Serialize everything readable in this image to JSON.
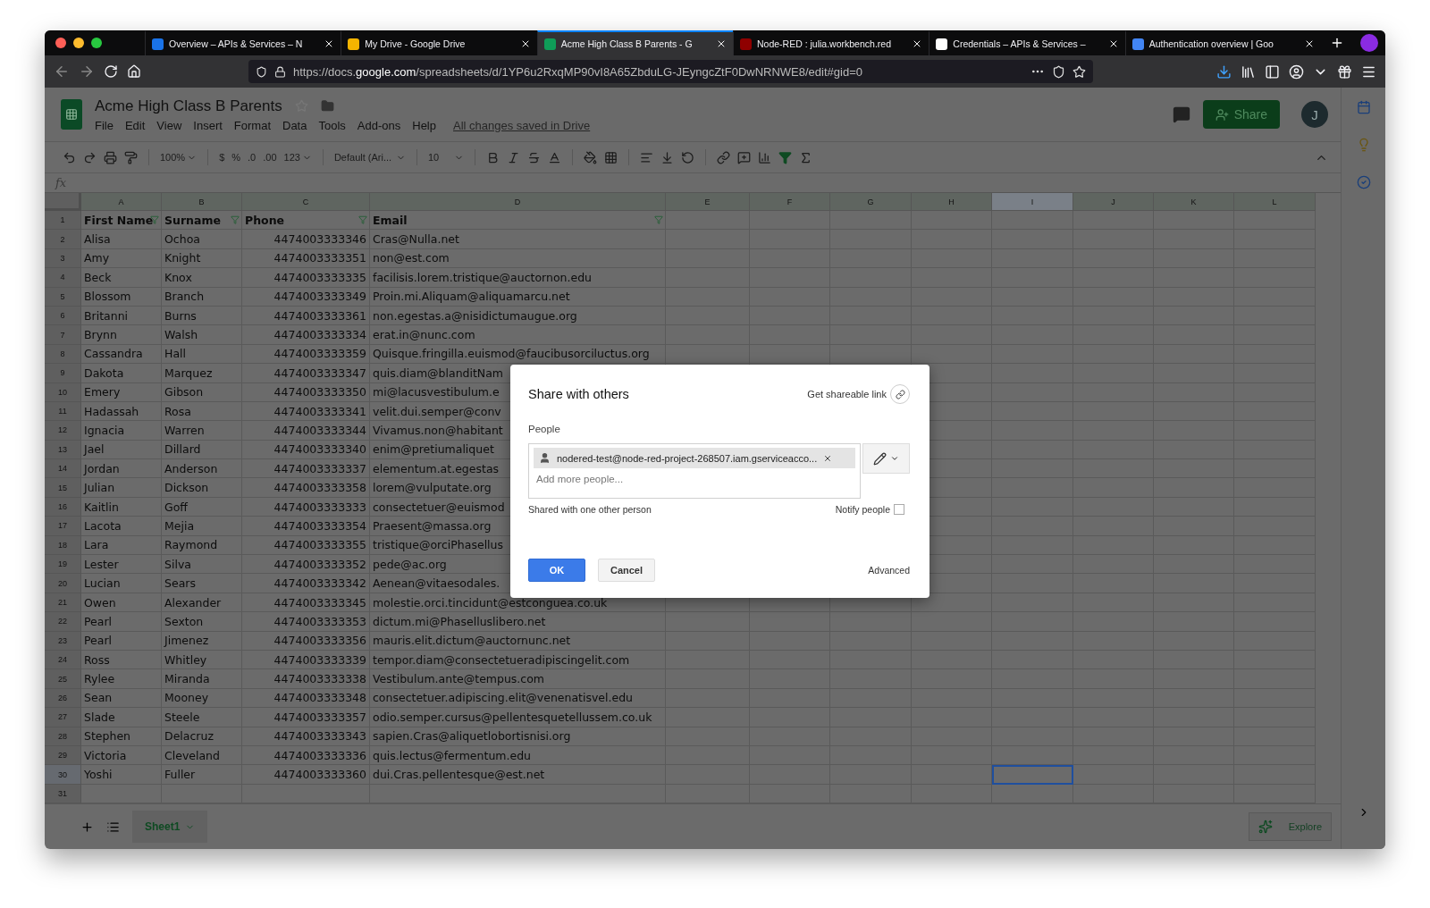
{
  "browser": {
    "tabs": [
      {
        "title": "Overview – APIs & Services – N",
        "selected": false
      },
      {
        "title": "My Drive - Google Drive",
        "selected": false
      },
      {
        "title": "Acme High Class B Parents - G",
        "selected": true
      },
      {
        "title": "Node-RED : julia.workbench.red",
        "selected": false
      },
      {
        "title": "Credentials – APIs & Services –",
        "selected": false
      },
      {
        "title": "Authentication overview  |  Goo",
        "selected": false
      }
    ],
    "url": {
      "prefix": "https://docs.",
      "host": "google.com",
      "path": "/spreadsheets/d/1YP6u2RxqMP90vI8A65ZbduLG-JEyngcZtF0DwNRNWE8/edit#gid=0"
    }
  },
  "doc": {
    "title": "Acme High Class B Parents",
    "menu": [
      "File",
      "Edit",
      "View",
      "Insert",
      "Format",
      "Data",
      "Tools",
      "Add-ons",
      "Help"
    ],
    "save_status": "All changes saved in Drive",
    "share_button": "Share",
    "avatar": "J"
  },
  "toolbar": {
    "zoom": "100%",
    "currency": "$",
    "percent": "%",
    "decrease_decimals": ".0",
    "increase_decimals": ".00",
    "more_formats": "123",
    "font": "Default (Ari...",
    "font_size": "10"
  },
  "formula_bar": {
    "label": "fx"
  },
  "sheet": {
    "columns": [
      {
        "label": "A",
        "selected": false
      },
      {
        "label": "B",
        "selected": false
      },
      {
        "label": "C",
        "selected": false
      },
      {
        "label": "D",
        "selected": false
      },
      {
        "label": "E",
        "selected": false
      },
      {
        "label": "F",
        "selected": false
      },
      {
        "label": "G",
        "selected": false
      },
      {
        "label": "H",
        "selected": false
      },
      {
        "label": "I",
        "selected": true
      },
      {
        "label": "J",
        "selected": false
      },
      {
        "label": "K",
        "selected": false
      },
      {
        "label": "L",
        "selected": false
      }
    ],
    "rows": [
      {
        "number": "1",
        "kind": "header",
        "selected": false,
        "cells": [
          "First Name",
          "Surname",
          "Phone",
          "Email"
        ]
      },
      {
        "number": "2",
        "kind": "data",
        "selected": false,
        "cells": [
          "Alisa",
          "Ochoa",
          "4474003333346",
          "Cras@Nulla.net"
        ]
      },
      {
        "number": "3",
        "kind": "data",
        "selected": false,
        "cells": [
          "Amy",
          "Knight",
          "4474003333351",
          "non@est.com"
        ]
      },
      {
        "number": "4",
        "kind": "data",
        "selected": false,
        "cells": [
          "Beck",
          "Knox",
          "4474003333335",
          "facilisis.lorem.tristique@auctornon.edu"
        ]
      },
      {
        "number": "5",
        "kind": "data",
        "selected": false,
        "cells": [
          "Blossom",
          "Branch",
          "4474003333349",
          "Proin.mi.Aliquam@aliquamarcu.net"
        ]
      },
      {
        "number": "6",
        "kind": "data",
        "selected": false,
        "cells": [
          "Britanni",
          "Burns",
          "4474003333361",
          "non.egestas.a@nisidictumaugue.org"
        ]
      },
      {
        "number": "7",
        "kind": "data",
        "selected": false,
        "cells": [
          "Brynn",
          "Walsh",
          "4474003333334",
          "erat.in@nunc.com"
        ]
      },
      {
        "number": "8",
        "kind": "data",
        "selected": false,
        "cells": [
          "Cassandra",
          "Hall",
          "4474003333359",
          "Quisque.fringilla.euismod@faucibusorciluctus.org"
        ]
      },
      {
        "number": "9",
        "kind": "data",
        "selected": false,
        "cells": [
          "Dakota",
          "Marquez",
          "4474003333347",
          "quis.diam@blanditNam"
        ]
      },
      {
        "number": "10",
        "kind": "data",
        "selected": false,
        "cells": [
          "Emery",
          "Gibson",
          "4474003333350",
          "mi@lacusvestibulum.e"
        ]
      },
      {
        "number": "11",
        "kind": "data",
        "selected": false,
        "cells": [
          "Hadassah",
          "Rosa",
          "4474003333341",
          "velit.dui.semper@conv"
        ]
      },
      {
        "number": "12",
        "kind": "data",
        "selected": false,
        "cells": [
          "Ignacia",
          "Warren",
          "4474003333344",
          "Vivamus.non@habitant"
        ]
      },
      {
        "number": "13",
        "kind": "data",
        "selected": false,
        "cells": [
          "Jael",
          "Dillard",
          "4474003333340",
          "enim@pretiumaliquet"
        ]
      },
      {
        "number": "14",
        "kind": "data",
        "selected": false,
        "cells": [
          "Jordan",
          "Anderson",
          "4474003333337",
          "elementum.at.egestas"
        ]
      },
      {
        "number": "15",
        "kind": "data",
        "selected": false,
        "cells": [
          "Julian",
          "Dickson",
          "4474003333358",
          "lorem@vulputate.org"
        ]
      },
      {
        "number": "16",
        "kind": "data",
        "selected": false,
        "cells": [
          "Kaitlin",
          "Goff",
          "4474003333333",
          "consectetuer@euismod"
        ]
      },
      {
        "number": "17",
        "kind": "data",
        "selected": false,
        "cells": [
          "Lacota",
          "Mejia",
          "4474003333354",
          "Praesent@massa.org"
        ]
      },
      {
        "number": "18",
        "kind": "data",
        "selected": false,
        "cells": [
          "Lara",
          "Raymond",
          "4474003333355",
          "tristique@orciPhasellus"
        ]
      },
      {
        "number": "19",
        "kind": "data",
        "selected": false,
        "cells": [
          "Lester",
          "Silva",
          "4474003333352",
          "pede@ac.org"
        ]
      },
      {
        "number": "20",
        "kind": "data",
        "selected": false,
        "cells": [
          "Lucian",
          "Sears",
          "4474003333342",
          "Aenean@vitaesodales."
        ]
      },
      {
        "number": "21",
        "kind": "data",
        "selected": false,
        "cells": [
          "Owen",
          "Alexander",
          "4474003333345",
          "molestie.orci.tincidunt@estconguea.co.uk"
        ]
      },
      {
        "number": "22",
        "kind": "data",
        "selected": false,
        "cells": [
          "Pearl",
          "Sexton",
          "4474003333353",
          "dictum.mi@Phaselluslibero.net"
        ]
      },
      {
        "number": "23",
        "kind": "data",
        "selected": false,
        "cells": [
          "Pearl",
          "Jimenez",
          "4474003333356",
          "mauris.elit.dictum@auctornunc.net"
        ]
      },
      {
        "number": "24",
        "kind": "data",
        "selected": false,
        "cells": [
          "Ross",
          "Whitley",
          "4474003333339",
          "tempor.diam@consectetueradipiscingelit.com"
        ]
      },
      {
        "number": "25",
        "kind": "data",
        "selected": false,
        "cells": [
          "Rylee",
          "Miranda",
          "4474003333338",
          "Vestibulum.ante@tempus.com"
        ]
      },
      {
        "number": "26",
        "kind": "data",
        "selected": false,
        "cells": [
          "Sean",
          "Mooney",
          "4474003333348",
          "consectetuer.adipiscing.elit@venenatisvel.edu"
        ]
      },
      {
        "number": "27",
        "kind": "data",
        "selected": false,
        "cells": [
          "Slade",
          "Steele",
          "4474003333357",
          "odio.semper.cursus@pellentesquetellussem.co.uk"
        ]
      },
      {
        "number": "28",
        "kind": "data",
        "selected": false,
        "cells": [
          "Stephen",
          "Delacruz",
          "4474003333343",
          "sapien.Cras@aliquetlobortisnisi.org"
        ]
      },
      {
        "number": "29",
        "kind": "data",
        "selected": false,
        "cells": [
          "Victoria",
          "Cleveland",
          "4474003333336",
          "quis.lectus@fermentum.edu"
        ]
      },
      {
        "number": "30",
        "kind": "data",
        "selected": true,
        "cells": [
          "Yoshi",
          "Fuller",
          "4474003333360",
          "dui.Cras.pellentesque@est.net"
        ]
      },
      {
        "number": "31",
        "kind": "data",
        "selected": false
      }
    ]
  },
  "sheet_tabs": [
    {
      "label": "Sheet1",
      "selected": true
    }
  ],
  "explore": "Explore",
  "dialog": {
    "title": "Share with others",
    "link": "Get shareable link",
    "people_label": "People",
    "person": "nodered-test@node-red-project-268507.iam.gserviceacco...",
    "placeholder": "Add more people...",
    "shared_status": "Shared with one other person",
    "notify": {
      "label": "Notify people",
      "checked": false
    },
    "ok": "OK",
    "cancel": "Cancel",
    "advanced": "Advanced"
  }
}
